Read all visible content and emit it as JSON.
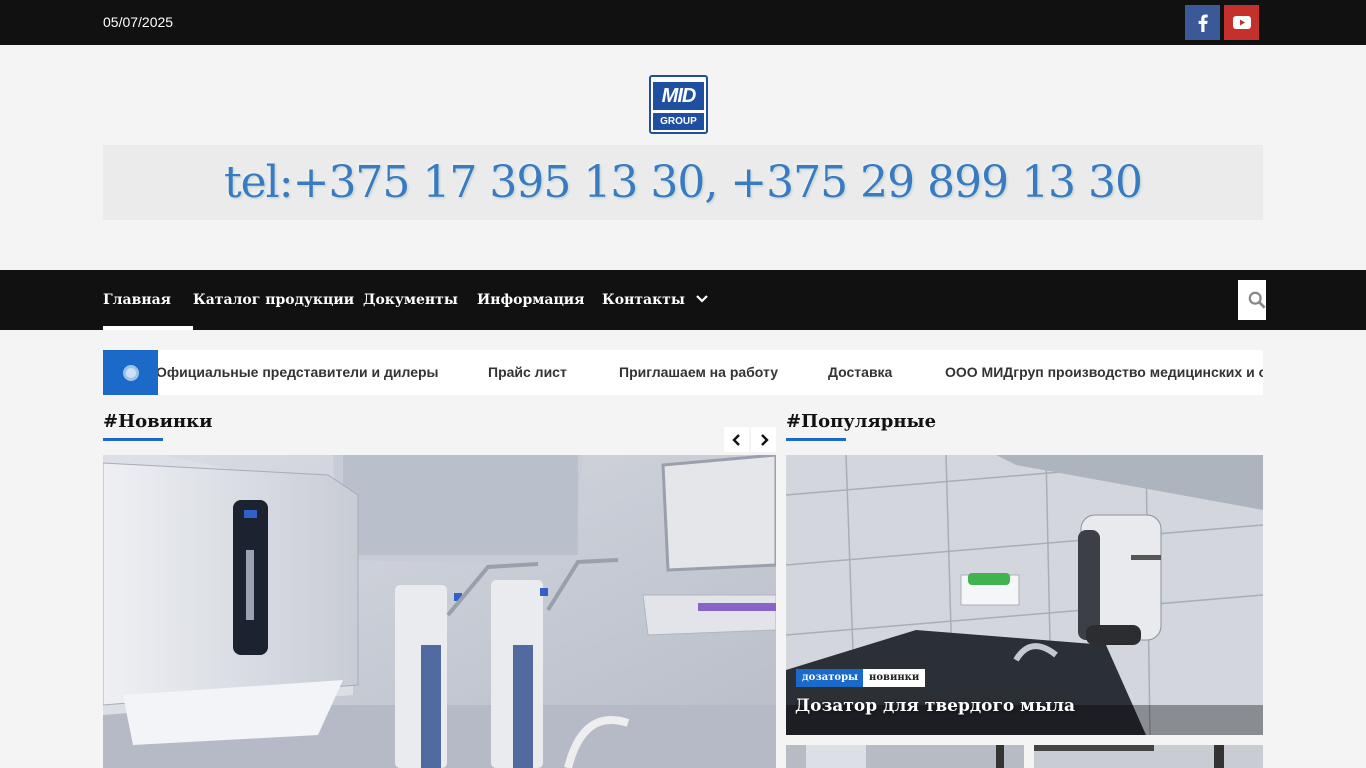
{
  "topbar": {
    "date": "05/07/2025",
    "social": [
      {
        "icon": "facebook-icon",
        "color": "#3b5998"
      },
      {
        "icon": "youtube-icon",
        "color": "#c4302b"
      }
    ]
  },
  "header": {
    "logo_top": "MID",
    "logo_bottom": "GROUP",
    "phone_banner": "tel:+375 17 395 13 30, +375 29 899 13 30"
  },
  "nav": {
    "items": [
      {
        "label": "Главная",
        "active": true
      },
      {
        "label": "Каталог продукции"
      },
      {
        "label": "Документы"
      },
      {
        "label": "Информация"
      },
      {
        "label": "Контакты",
        "has_dropdown": true
      }
    ],
    "search_icon": "search-icon"
  },
  "ticker": {
    "items": [
      "Официальные представители и дилеры",
      "Прайс лист",
      "Приглашаем на работу",
      "Доставка",
      "ООО МИДгруп производство медицинских и са"
    ]
  },
  "sections": {
    "new": {
      "title": "#Новинки"
    },
    "popular": {
      "title": "#Популярные",
      "tags": [
        "дозаторы",
        "новинки"
      ],
      "post_title": "Дозатор для твердого мыла"
    }
  },
  "colors": {
    "accent": "#1b6ac9",
    "topbar": "#111111",
    "phone_text": "#3a7bc0"
  }
}
